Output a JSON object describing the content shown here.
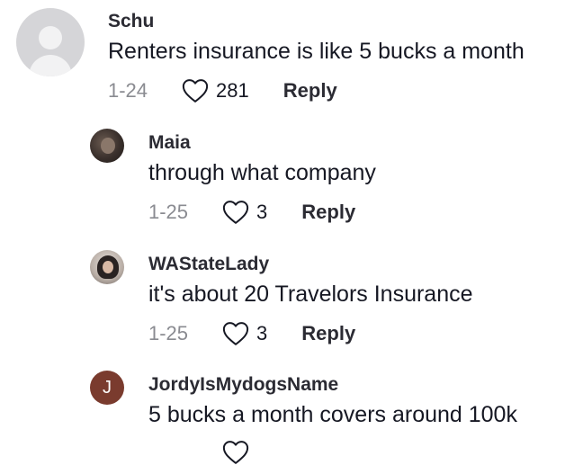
{
  "comments": [
    {
      "username": "Schu",
      "text": "Renters insurance is like 5 bucks a month",
      "date": "1-24",
      "likes": "281",
      "reply_label": "Reply"
    },
    {
      "username": "Maia",
      "text": "through what company",
      "date": "1-25",
      "likes": "3",
      "reply_label": "Reply"
    },
    {
      "username": "WAStateLady",
      "text": "it's about 20 Travelors Insurance",
      "date": "1-25",
      "likes": "3",
      "reply_label": "Reply"
    },
    {
      "username": "JordyIsMydogsName",
      "avatar_letter": "J",
      "text": "5 bucks a month covers around 100k"
    }
  ],
  "colors": {
    "text": "#161823",
    "muted": "#8a8b91",
    "letter_avatar": "#7a3b2e"
  },
  "icons": {
    "like": "heart-outline-icon",
    "default_avatar": "default-avatar-icon"
  }
}
